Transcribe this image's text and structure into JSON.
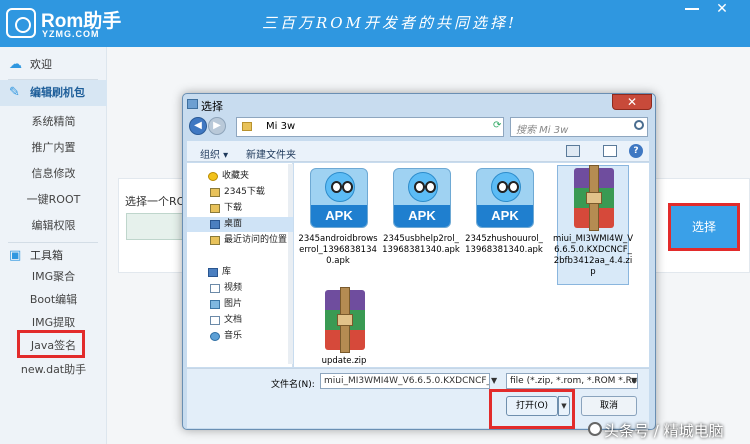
{
  "app": {
    "logo_name": "Rom助手",
    "logo_domain": "YZMG.COM",
    "slogan": "三百万ROM开发者的共同选择!",
    "accent_color": "#2f97e0",
    "highlight_color": "#e22b2b"
  },
  "sidebar": {
    "welcome": "欢迎",
    "edit_pack": "编辑刷机包",
    "items": [
      "系统精简",
      "推广内置",
      "信息修改",
      "一键ROOT",
      "编辑权限"
    ],
    "toolbox": "工具箱",
    "tools": [
      "IMG聚合",
      "Boot编辑",
      "IMG提取",
      "Java签名",
      "new.dat助手"
    ]
  },
  "main": {
    "prompt": "选择一个RO",
    "select_button": "选择"
  },
  "dialog": {
    "title": "选择",
    "address": "Mi 3w",
    "search_placeholder": "搜索 Mi 3w",
    "organize": "组织 ▾",
    "new_folder": "新建文件夹",
    "nav": {
      "favorites": "收藏夹",
      "downloads_2345": "2345下载",
      "downloads": "下载",
      "desktop": "桌面",
      "recent": "最近访问的位置",
      "libraries": "库",
      "videos": "视频",
      "pictures": "图片",
      "documents": "文档",
      "music": "音乐"
    },
    "files": [
      {
        "name": "2345androidbrowserrol_13968381340.apk",
        "type": "apk",
        "icon_label": "APK"
      },
      {
        "name": "2345usbhelp2rol_13968381340.apk",
        "type": "apk",
        "icon_label": "APK"
      },
      {
        "name": "2345zhushouurol_13968381340.apk",
        "type": "apk",
        "icon_label": "APK"
      },
      {
        "name": "miui_MI3WMI4W_V6.6.5.0.KXDCNCF_2bfb3412aa_4.4.zip",
        "type": "zip"
      },
      {
        "name": "update.zip",
        "type": "zip"
      }
    ],
    "filename_label": "文件名(N):",
    "filename_value": "miui_MI3WMI4W_V6.6.5.0.KXDCNCF_2bf",
    "filter_value": "file (*.zip, *.rom, *.ROM *.Rom",
    "open_button": "打开(O)",
    "cancel_button": "取消"
  },
  "watermark": "头条号 / 精城电脑"
}
